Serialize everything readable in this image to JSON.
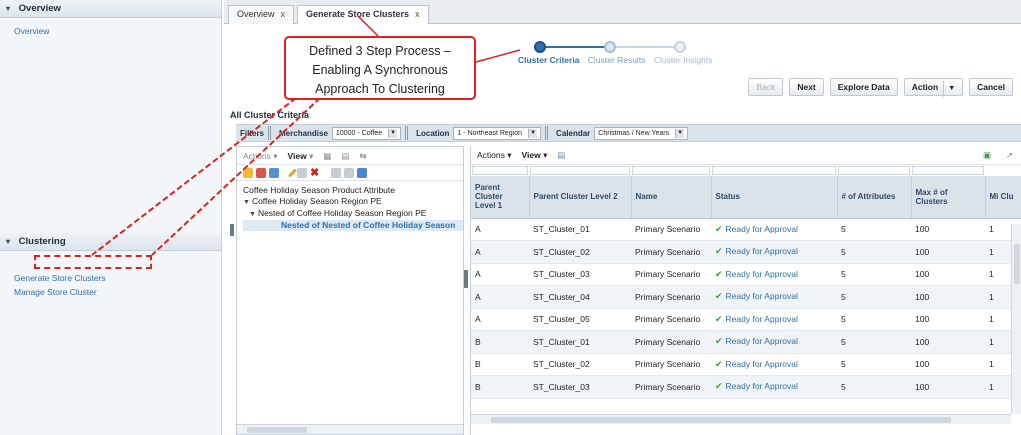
{
  "leftnav": {
    "overview_header": "Overview",
    "overview_link": "Overview",
    "clustering_header": "Clustering",
    "clustering_links": [
      "Generate Store Clusters",
      "Manage Store Cluster"
    ]
  },
  "tabs": [
    {
      "label": "Overview",
      "close": "x"
    },
    {
      "label": "Generate Store Clusters",
      "close": "x"
    }
  ],
  "train": {
    "steps": [
      "Cluster Criteria",
      "Cluster Results",
      "Cluster Insights"
    ],
    "current_step": 0
  },
  "actions": {
    "back": "Back",
    "next": "Next",
    "explore": "Explore Data",
    "action": "Action",
    "cancel": "Cancel"
  },
  "section_title": "All Cluster Criteria",
  "filters": {
    "label": "Filters",
    "merchandise_label": "Merchandise",
    "merchandise_value": "10000 - Coffee",
    "location_label": "Location",
    "location_value": "1 - Northeast Region",
    "calendar_label": "Calendar",
    "calendar_value": "Christmas / New Years"
  },
  "tree_panel": {
    "actions": "Actions",
    "view": "View",
    "items": [
      "Coffee Holiday Season Product Attribute",
      "Coffee Holiday Season Region PE",
      "Nested of Coffee Holiday Season Region PE",
      "Nested of Nested of Coffee Holiday Season"
    ]
  },
  "grid": {
    "actions": "Actions",
    "view": "View",
    "columns": [
      "Parent Cluster Level 1",
      "Parent Cluster Level 2",
      "Name",
      "Status",
      "# of Attributes",
      "Max # of Clusters",
      "Mi Clu"
    ],
    "rows": [
      [
        "A",
        "ST_Cluster_01",
        "Primary Scenario",
        "Ready for Approval",
        "5",
        "100",
        "1"
      ],
      [
        "A",
        "ST_Cluster_02",
        "Primary Scenario",
        "Ready for Approval",
        "5",
        "100",
        "1"
      ],
      [
        "A",
        "ST_Cluster_03",
        "Primary Scenario",
        "Ready for Approval",
        "5",
        "100",
        "1"
      ],
      [
        "A",
        "ST_Cluster_04",
        "Primary Scenario",
        "Ready for Approval",
        "5",
        "100",
        "1"
      ],
      [
        "A",
        "ST_Cluster_05",
        "Primary Scenario",
        "Ready for Approval",
        "5",
        "100",
        "1"
      ],
      [
        "B",
        "ST_Cluster_01",
        "Primary Scenario",
        "Ready for Approval",
        "5",
        "100",
        "1"
      ],
      [
        "B",
        "ST_Cluster_02",
        "Primary Scenario",
        "Ready for Approval",
        "5",
        "100",
        "1"
      ],
      [
        "B",
        "ST_Cluster_03",
        "Primary Scenario",
        "Ready for Approval",
        "5",
        "100",
        "1"
      ]
    ]
  },
  "callout": {
    "lines": [
      "Defined 3 Step Process –",
      "Enabling A Synchronous",
      "Approach To Clustering"
    ]
  },
  "colors": {
    "accent": "#2f6fb0",
    "annotation": "#e02020",
    "status_ok": "#3a9a3a"
  }
}
